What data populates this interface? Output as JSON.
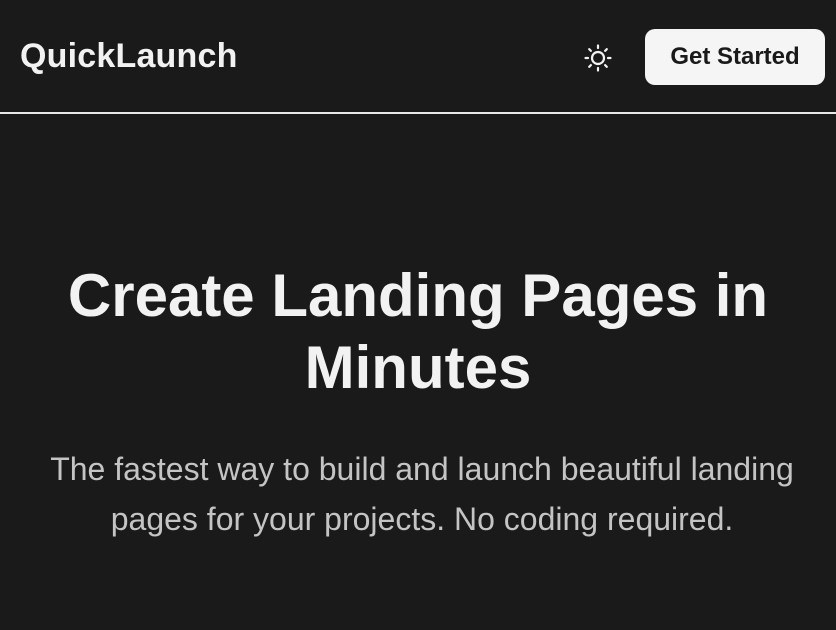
{
  "header": {
    "brand": "QuickLaunch",
    "theme_toggle_icon": "sun-icon",
    "cta_label": "Get Started"
  },
  "hero": {
    "title": "Create Landing Pages in Minutes",
    "subtitle": "The fastest way to build and launch beautiful landing pages for your projects. No coding required."
  },
  "colors": {
    "background": "#1a1a1a",
    "text_primary": "#f2f2f2",
    "text_secondary": "#c4c4c4",
    "button_background": "#f5f5f5",
    "button_text": "#1a1a1a",
    "divider": "#e8e8e8"
  }
}
